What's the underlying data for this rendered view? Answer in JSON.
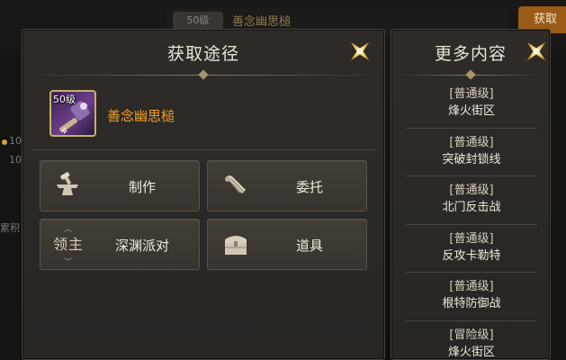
{
  "background": {
    "top_badge": "50级",
    "top_title": "善念幽思槌",
    "top_button": "获取",
    "left_items": [
      "10",
      "10",
      "累积"
    ]
  },
  "acquire_panel": {
    "title": "获取途径",
    "item": {
      "level": "50级",
      "name": "善念幽思槌",
      "icon": "hammer-item-icon",
      "name_color": "#f2a12a"
    },
    "actions": [
      {
        "label": "制作",
        "icon": "anvil-icon"
      },
      {
        "label": "委托",
        "icon": "scroll-icon"
      },
      {
        "label": "深渊派对",
        "icon": "lord-icon",
        "icon_text": "领主"
      },
      {
        "label": "道具",
        "icon": "chest-icon"
      }
    ]
  },
  "more_panel": {
    "title": "更多内容",
    "items": [
      {
        "tier": "[普通级]",
        "name": "烽火街区"
      },
      {
        "tier": "[普通级]",
        "name": "突破封锁线"
      },
      {
        "tier": "[普通级]",
        "name": "北门反击战"
      },
      {
        "tier": "[普通级]",
        "name": "反攻卡勒特"
      },
      {
        "tier": "[普通级]",
        "name": "根特防御战"
      },
      {
        "tier": "[冒险级]",
        "name": "烽火街区"
      }
    ]
  }
}
